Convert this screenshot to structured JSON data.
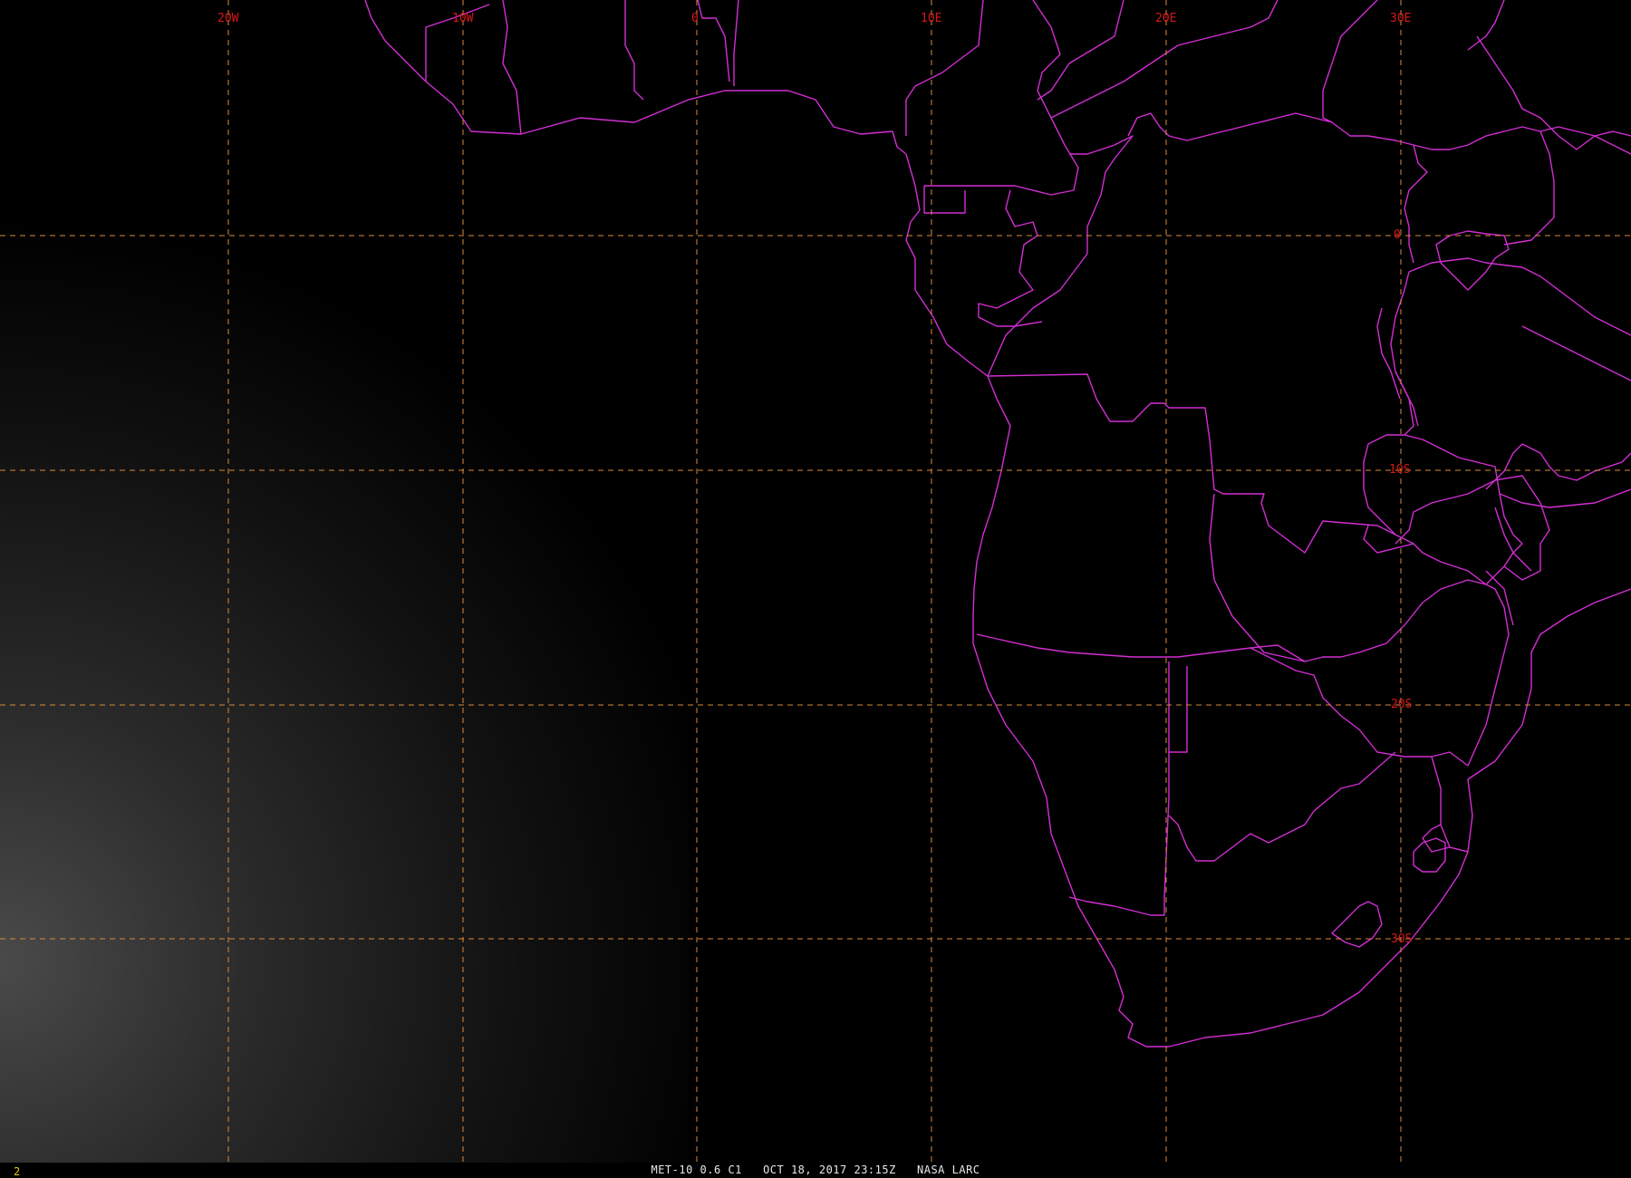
{
  "map": {
    "longitude_labels": [
      {
        "text": "20W",
        "lon": -20
      },
      {
        "text": "10W",
        "lon": -10
      },
      {
        "text": "0",
        "lon": 0
      },
      {
        "text": "10E",
        "lon": 10
      },
      {
        "text": "20E",
        "lon": 20
      },
      {
        "text": "30E",
        "lon": 30
      }
    ],
    "latitude_labels": [
      {
        "text": "0",
        "lat": 0
      },
      {
        "text": "10S",
        "lat": -10
      },
      {
        "text": "20S",
        "lat": -20
      },
      {
        "text": "30S",
        "lat": -30
      }
    ],
    "colors": {
      "background": "#000000",
      "coastline": "#d22ed2",
      "grid": "#d98a3c",
      "grid_label": "#d81818",
      "caption": "#e8e8e8",
      "frame_number": "#e6c800"
    }
  },
  "status_bar": {
    "frame_number": "2",
    "caption": "MET-10 0.6 C1   OCT 18, 2017 23:15Z   NASA LARC"
  }
}
